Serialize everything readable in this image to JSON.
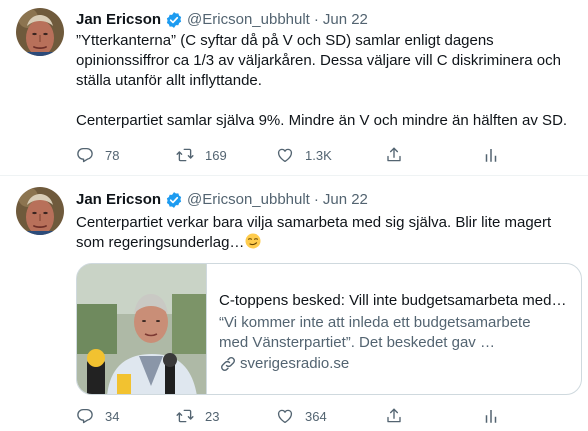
{
  "colors": {
    "verified": "#1d9bf0",
    "text": "#0f1419",
    "muted": "#536471",
    "border": "#cfd9de"
  },
  "tweets": [
    {
      "author_name": "Jan Ericson",
      "handle": "@Ericson_ubbhult",
      "separator": "·",
      "date": "Jun 22",
      "paragraphs": [
        "”Ytterkanterna” (C syftar då på V och SD) samlar enligt dagens opinionssiffror ca 1/3 av väljarkåren. Dessa väljare vill C diskriminera och ställa utanför allt inflyttande.",
        "Centerpartiet samlar själva 9%. Mindre än V och mindre än hälften av SD."
      ],
      "replies": "78",
      "retweets": "169",
      "likes": "1.3K"
    },
    {
      "author_name": "Jan Ericson",
      "handle": "@Ericson_ubbhult",
      "separator": "·",
      "date": "Jun 22",
      "text": "Centerpartiet verkar bara vilja samarbeta med sig själva. Blir lite magert som regeringsunderlag…",
      "emoji": "smirking-face",
      "card": {
        "title": "C-toppens besked: Vill inte budgetsamarbeta med …",
        "description": "“Vi kommer inte att inleda ett budgetsamarbete med Vänsterpartiet”. Det beskedet gav …",
        "domain": "sverigesradio.se"
      },
      "replies": "34",
      "retweets": "23",
      "likes": "364"
    }
  ],
  "icons": [
    "reply-icon",
    "retweet-icon",
    "like-icon",
    "share-icon",
    "analytics-icon",
    "verified-icon",
    "link-icon"
  ]
}
